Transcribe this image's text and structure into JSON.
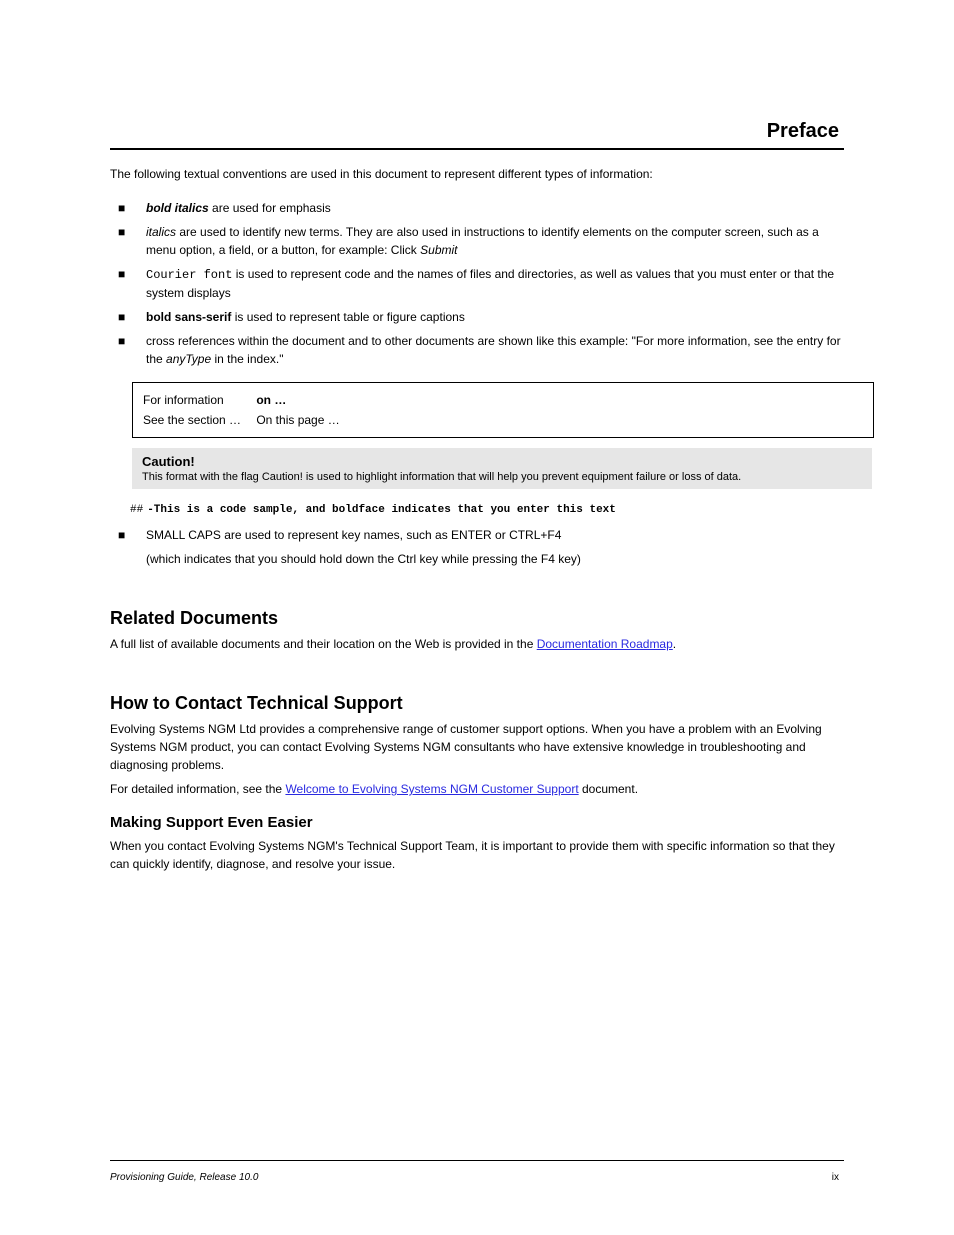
{
  "header": {
    "title": "Preface"
  },
  "intro": "The following textual conventions are used in this document to represent different types of information:",
  "conventions": [
    {
      "prefix": "■ ",
      "label": "bold italics",
      "label_class": "bold-ital",
      "rest": " are used for emphasis"
    },
    {
      "prefix": "■ ",
      "label": "italics",
      "label_class": "italic",
      "rest": " are used to identify new terms. They are also used in instructions to identify elements on the computer screen, such as a menu option, a field, or a button, for example: Click ",
      "example": "Submit",
      "example_class": "italic",
      "rest2": ""
    },
    {
      "prefix": "■ ",
      "label": "Courier font",
      "label_class": "courier",
      "rest": " is used to represent code and the names of files and directories, as well as values that you must enter or that the system displays"
    },
    {
      "prefix": "■ ",
      "label": "bold sans-serif",
      "label_class": "sans-bold",
      "rest": " is used to represent table or figure captions"
    },
    {
      "prefix": "■    ",
      "label": "",
      "label_class": "",
      "rest": "cross references within the document and to other documents are shown like this example: \"For more information, see the entry for the ",
      "example": "anyType",
      "example_class": "italic",
      "rest2": " in the index.\""
    }
  ],
  "for_info": {
    "line1_label": "For information",
    "line1_text": "on …",
    "line2_label": "See the section …",
    "line2_text": "On this page …"
  },
  "caution": {
    "title": "Caution!",
    "body": "This format with the flag Caution! is used to highlight information that will help you prevent equipment failure or loss of data."
  },
  "code": {
    "line1": "##",
    "line1b": "-This is a code sample, and boldface indicates that you enter this text"
  },
  "key_combo": {
    "prefix": "■ ",
    "label": "SMALL CAPS",
    "rest": " are used to represent key names, such as ",
    "k1": "ENTER",
    "mid": " or ",
    "k2": "CTRL+F4"
  },
  "key_combo_line2": "(which indicates that you should hold down the Ctrl key while pressing the F4 key)",
  "related_docs": {
    "heading": "Related Documents",
    "body_before": "A full list of available documents and their location on the Web is provided in the ",
    "link_text": "Documentation Roadmap",
    "body_after": "."
  },
  "support": {
    "heading": "How to Contact Technical Support",
    "p1": "Evolving Systems NGM Ltd provides a comprehensive range of customer support options. When you have a problem with an Evolving Systems NGM product, you can contact Evolving Systems NGM consultants who have extensive knowledge in troubleshooting and diagnosing problems.",
    "p2_before": "For detailed information, see the ",
    "p2_link": "Welcome to Evolving Systems NGM Customer Support",
    "p2_after": " document.",
    "sub_heading": "Making Support Even Easier",
    "sub_body": "When you contact Evolving Systems NGM's Technical Support Team, it is important to provide them with specific information so that they can quickly identify, diagnose, and resolve your issue."
  },
  "footer": {
    "left": "Provisioning Guide, Release 10.0",
    "right": "ix"
  }
}
